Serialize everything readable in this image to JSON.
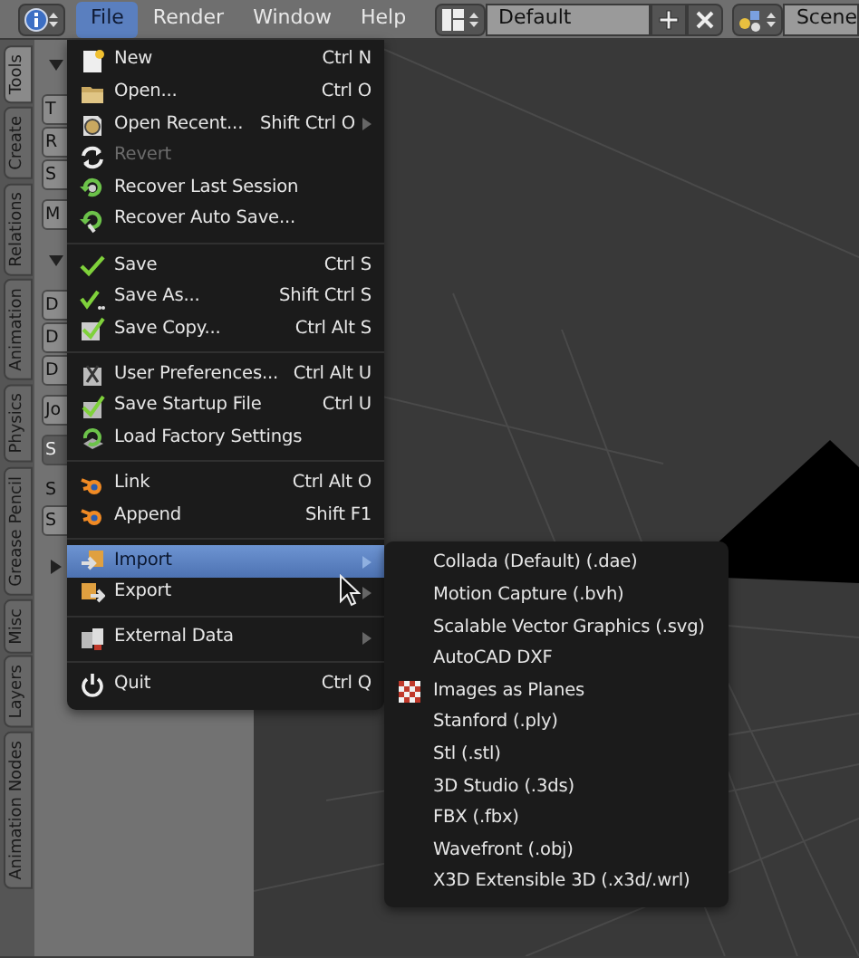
{
  "header": {
    "menus": [
      {
        "label": "File",
        "selected": true
      },
      {
        "label": "Render",
        "selected": false
      },
      {
        "label": "Window",
        "selected": false
      },
      {
        "label": "Help",
        "selected": false
      }
    ],
    "layout_field": "Default",
    "scene_field": "Scene"
  },
  "side_tabs": [
    {
      "label": "Tools",
      "selected": true
    },
    {
      "label": "Create",
      "selected": false
    },
    {
      "label": "Relations",
      "selected": false
    },
    {
      "label": "Animation",
      "selected": false
    },
    {
      "label": "Physics",
      "selected": false
    },
    {
      "label": "Grease Pencil",
      "selected": false
    },
    {
      "label": "Misc",
      "selected": false
    },
    {
      "label": "Layers",
      "selected": false
    },
    {
      "label": "Animation Nodes",
      "selected": false
    }
  ],
  "tool_panel": {
    "sections": [
      {
        "expanded": true,
        "groups": [
          [
            {
              "kind": "button",
              "label": "T",
              "selected": false
            },
            {
              "kind": "button",
              "label": "R",
              "selected": false
            },
            {
              "kind": "button",
              "label": "S",
              "selected": false
            }
          ],
          [
            {
              "kind": "button",
              "label": "M",
              "selected": false
            }
          ]
        ]
      },
      {
        "expanded": true,
        "groups": [
          [
            {
              "kind": "button",
              "label": "D",
              "selected": false
            },
            {
              "kind": "button",
              "label": "D",
              "selected": false
            },
            {
              "kind": "button",
              "label": "D",
              "selected": false
            }
          ],
          [
            {
              "kind": "button",
              "label": "Jo",
              "selected": false
            }
          ],
          [
            {
              "kind": "button",
              "label": "S",
              "selected": true
            }
          ],
          [
            {
              "kind": "text",
              "label": "S"
            },
            {
              "kind": "button",
              "label": "S",
              "selected": false
            }
          ]
        ]
      },
      {
        "expanded": false
      }
    ]
  },
  "file_menu": {
    "groups": [
      [
        {
          "label": "New",
          "shortcut": "Ctrl N",
          "submenu": false,
          "disabled": false,
          "selected": false
        },
        {
          "label": "Open...",
          "shortcut": "Ctrl O",
          "submenu": false,
          "disabled": false,
          "selected": false
        },
        {
          "label": "Open Recent...",
          "shortcut": "Shift Ctrl O",
          "submenu": true,
          "disabled": false,
          "selected": false
        },
        {
          "label": "Revert",
          "submenu": false,
          "disabled": true,
          "selected": false
        },
        {
          "label": "Recover Last Session",
          "submenu": false,
          "disabled": false,
          "selected": false
        },
        {
          "label": "Recover Auto Save...",
          "submenu": false,
          "disabled": false,
          "selected": false
        }
      ],
      [
        {
          "label": "Save",
          "shortcut": "Ctrl S",
          "submenu": false,
          "disabled": false,
          "selected": false
        },
        {
          "label": "Save As...",
          "shortcut": "Shift Ctrl S",
          "submenu": false,
          "disabled": false,
          "selected": false
        },
        {
          "label": "Save Copy...",
          "shortcut": "Ctrl Alt S",
          "submenu": false,
          "disabled": false,
          "selected": false
        }
      ],
      [
        {
          "label": "User Preferences...",
          "shortcut": "Ctrl Alt U",
          "submenu": false,
          "disabled": false,
          "selected": false
        },
        {
          "label": "Save Startup File",
          "shortcut": "Ctrl U",
          "submenu": false,
          "disabled": false,
          "selected": false
        },
        {
          "label": "Load Factory Settings",
          "submenu": false,
          "disabled": false,
          "selected": false
        }
      ],
      [
        {
          "label": "Link",
          "shortcut": "Ctrl Alt O",
          "submenu": false,
          "disabled": false,
          "selected": false
        },
        {
          "label": "Append",
          "shortcut": "Shift F1",
          "submenu": false,
          "disabled": false,
          "selected": false
        }
      ],
      [
        {
          "label": "Import",
          "submenu": true,
          "disabled": false,
          "selected": true
        },
        {
          "label": "Export",
          "submenu": true,
          "disabled": false,
          "selected": false
        }
      ],
      [
        {
          "label": "External Data",
          "submenu": true,
          "disabled": false,
          "selected": false
        }
      ],
      [
        {
          "label": "Quit",
          "shortcut": "Ctrl Q",
          "submenu": false,
          "disabled": false,
          "selected": false
        }
      ]
    ]
  },
  "import_submenu": {
    "items": [
      {
        "label": "Collada (Default) (.dae)",
        "selected": false
      },
      {
        "label": "Motion Capture (.bvh)",
        "selected": false
      },
      {
        "label": "Scalable Vector Graphics (.svg)",
        "selected": false
      },
      {
        "label": "AutoCAD DXF",
        "selected": false
      },
      {
        "label": "Images as Planes",
        "selected": false
      },
      {
        "label": "Stanford (.ply)",
        "selected": false
      },
      {
        "label": "Stl (.stl)",
        "selected": false
      },
      {
        "label": "3D Studio (.3ds)",
        "selected": false
      },
      {
        "label": "FBX (.fbx)",
        "selected": false
      },
      {
        "label": "Wavefront (.obj)",
        "selected": false
      },
      {
        "label": "X3D Extensible 3D (.x3d/.wrl)",
        "selected": false
      }
    ]
  }
}
